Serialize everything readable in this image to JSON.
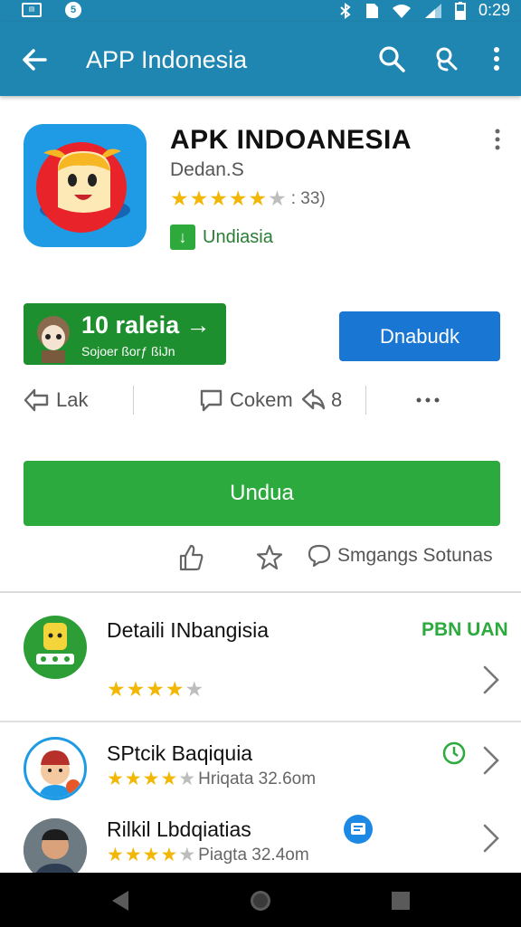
{
  "status_bar": {
    "notif_icon": "image-notification-icon",
    "time": "0:29"
  },
  "app_bar": {
    "title": "APP Indonesia",
    "icons": [
      "back-arrow-icon",
      "search-icon",
      "voice-search-icon",
      "more-vert-icon"
    ]
  },
  "app": {
    "name": "APK INDOANESIA",
    "developer": "Dedan.S",
    "stars_filled": 5,
    "stars_total": 6,
    "rating_count": ": 33)",
    "download_badge_label": "Undiasia"
  },
  "promo": {
    "title": "10 raleia →",
    "subtitle": "Sojoer ßorƒ ßiJn"
  },
  "blue_button_label": "Dnabudk",
  "actions": {
    "lak": "Lak",
    "comment": "Cokem",
    "share_count": "8"
  },
  "install_label": "Undua",
  "secondary": {
    "comments_label": "Smgangs Sotunas"
  },
  "list": [
    {
      "title": "Detaili INbangisia",
      "tag": "PBN UAN",
      "rating": 4,
      "meta": ""
    },
    {
      "title": "SPtcik Baqiquia",
      "rating": 4,
      "meta": "Hriqata 32.6om"
    },
    {
      "title": "Rilkil Lbdqiatias",
      "rating": 4,
      "meta": "Piagta 32.4om"
    }
  ],
  "colors": {
    "app_bar": "#1f86b1",
    "install_green": "#2caa3e",
    "promo_green": "#1e8f2e",
    "blue_button": "#1976d2",
    "star": "#f2b705"
  }
}
